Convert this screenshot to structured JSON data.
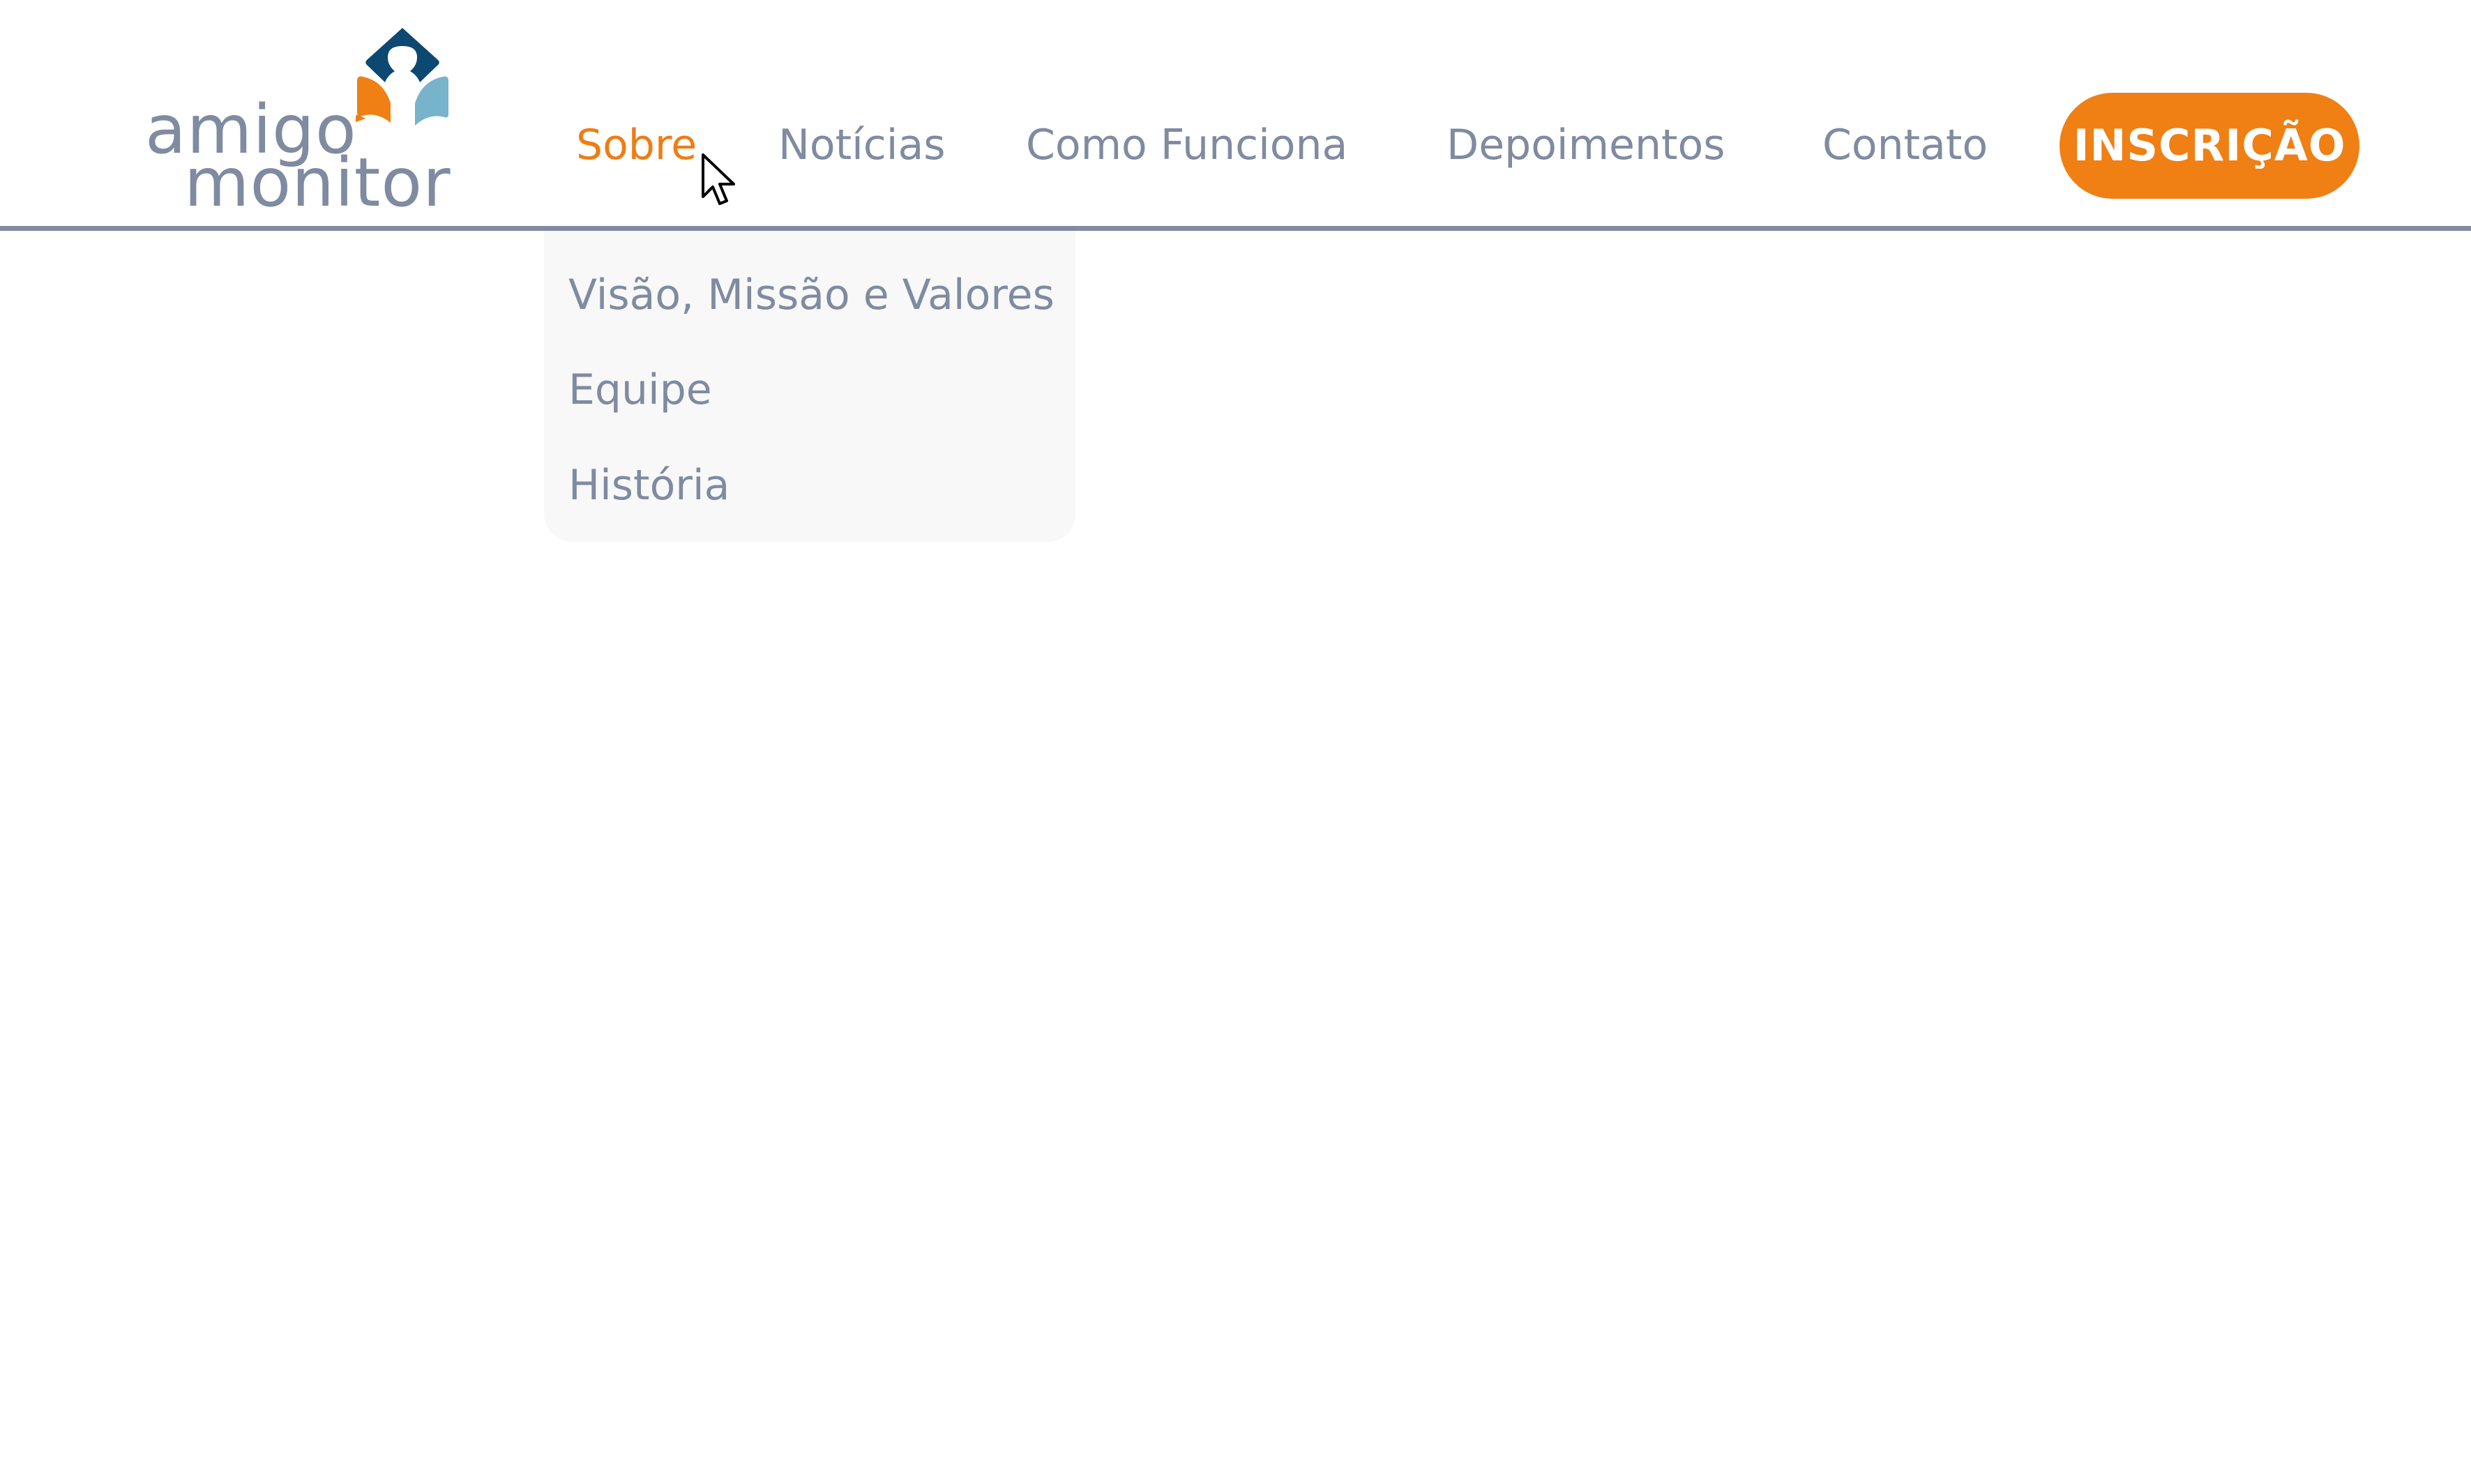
{
  "brand": {
    "logo_line1": "amigo",
    "logo_line2": "monitor",
    "colors": {
      "orange": "#f07f14",
      "navy": "#0d4872",
      "light_blue": "#78b3cc",
      "text_gray": "#7f8ba1"
    }
  },
  "nav": {
    "items": [
      {
        "label": "Sobre",
        "active": true
      },
      {
        "label": "Notícias",
        "active": false
      },
      {
        "label": "Como Funciona",
        "active": false
      },
      {
        "label": "Depoimentos",
        "active": false
      },
      {
        "label": "Contato",
        "active": false
      }
    ],
    "cta_label": "INSCRIÇÃO"
  },
  "dropdown": {
    "parent": "Sobre",
    "items": [
      {
        "label": "Visão, Missão e Valores"
      },
      {
        "label": "Equipe"
      },
      {
        "label": "História"
      }
    ]
  },
  "icons": {
    "logo": "amigo-monitor-logo-icon",
    "cursor": "mouse-pointer-icon"
  }
}
